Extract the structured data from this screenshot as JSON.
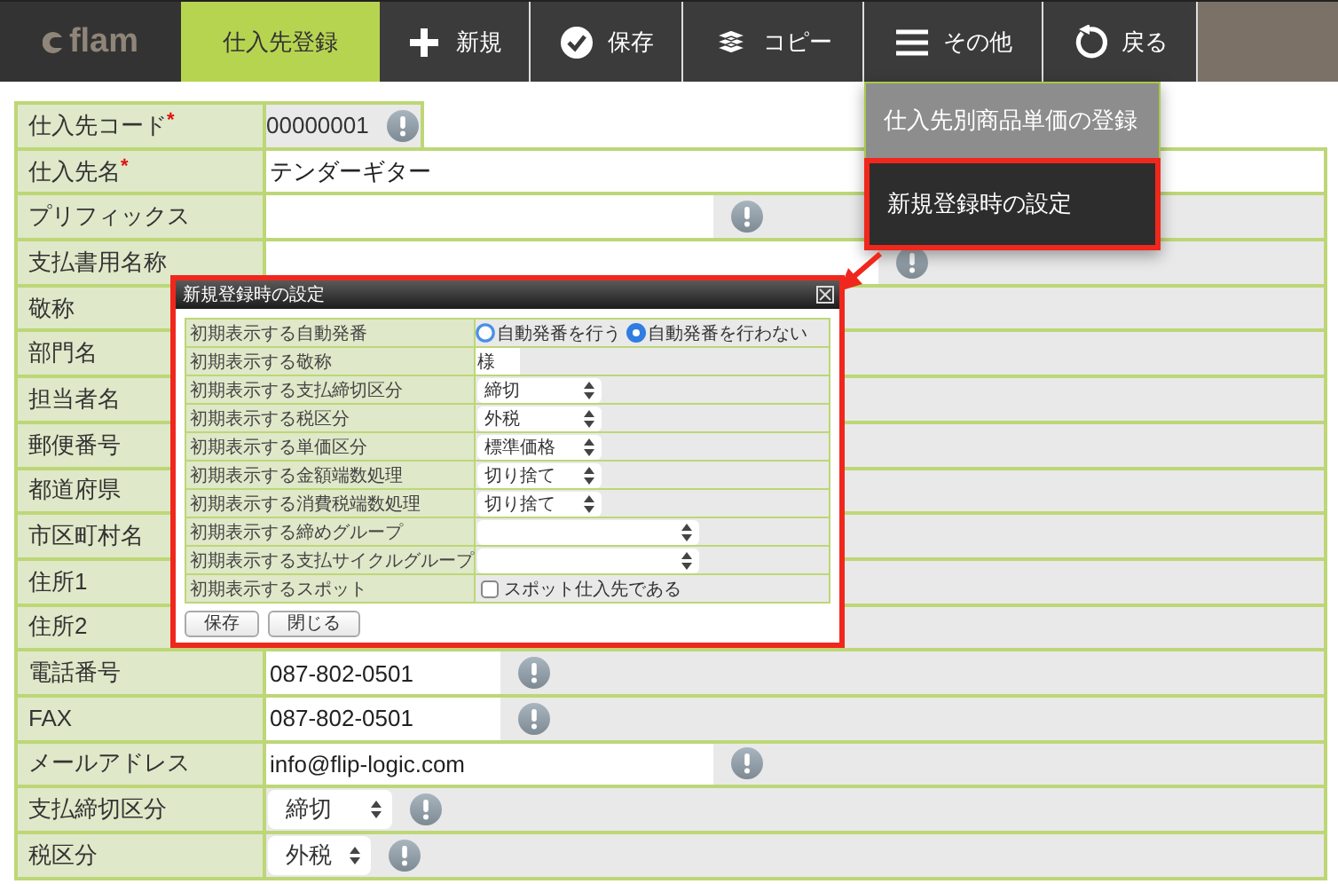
{
  "toolbar": {
    "logo": "flam",
    "items": [
      {
        "kind": "tab",
        "label": "仕入先登録",
        "selected": true
      },
      {
        "kind": "button",
        "label": "新規"
      },
      {
        "kind": "button",
        "label": "保存"
      },
      {
        "kind": "button",
        "label": "コピー"
      },
      {
        "kind": "button",
        "label": "その他"
      },
      {
        "kind": "button",
        "label": "戻る"
      }
    ]
  },
  "form": {
    "rows": [
      {
        "label": "仕入先コード",
        "required_mark": "*",
        "kind": "code",
        "value": "00000001"
      },
      {
        "label": "仕入先名",
        "required_mark": "*",
        "kind": "text",
        "value": "テンダーギター"
      },
      {
        "label": "プリフィックス",
        "kind": "text"
      },
      {
        "label": "支払書用名称",
        "kind": "text"
      },
      {
        "label": "敬称"
      },
      {
        "label": "部門名"
      },
      {
        "label": "担当者名"
      },
      {
        "label": "郵便番号"
      },
      {
        "label": "都道府県"
      },
      {
        "label": "市区町村名"
      },
      {
        "label": "住所1"
      },
      {
        "label": "住所2"
      },
      {
        "label": "電話番号",
        "kind": "text",
        "value": "087-802-0501"
      },
      {
        "label": "FAX",
        "kind": "text",
        "value": "087-802-0501"
      },
      {
        "label": "メールアドレス",
        "kind": "text",
        "value": "info@flip-logic.com"
      },
      {
        "label": "支払締切区分",
        "kind": "select",
        "value": "締切"
      },
      {
        "label": "税区分",
        "kind": "select",
        "value": "外税"
      }
    ]
  },
  "menu": {
    "items": [
      {
        "label": "仕入先別商品単価の登録",
        "selected": false,
        "highlighted": false
      },
      {
        "label": "新規登録時の設定",
        "selected": true,
        "highlighted": true
      }
    ]
  },
  "dialog": {
    "title": "新規登録時の設定",
    "highlighted": true,
    "rows": [
      {
        "label": "初期表示する自動発番",
        "kind": "radio",
        "options": [
          {
            "label": "自動発番を行う",
            "selected": false
          },
          {
            "label": "自動発番を行わない",
            "selected": true
          }
        ]
      },
      {
        "label": "初期表示する敬称",
        "kind": "text",
        "value": "様"
      },
      {
        "label": "初期表示する支払締切区分",
        "kind": "select",
        "value": "締切"
      },
      {
        "label": "初期表示する税区分",
        "kind": "select",
        "value": "外税"
      },
      {
        "label": "初期表示する単価区分",
        "kind": "select",
        "value": "標準価格"
      },
      {
        "label": "初期表示する金額端数処理",
        "kind": "select",
        "value": "切り捨て"
      },
      {
        "label": "初期表示する消費税端数処理",
        "kind": "select",
        "value": "切り捨て"
      },
      {
        "label": "初期表示する締めグループ",
        "kind": "select"
      },
      {
        "label": "初期表示する支払サイクルグループ",
        "kind": "select"
      },
      {
        "label": "初期表示するスポット",
        "kind": "checkbox",
        "option": "スポット仕入先である",
        "checked": false
      }
    ],
    "buttons": [
      "保存",
      "閉じる"
    ]
  }
}
